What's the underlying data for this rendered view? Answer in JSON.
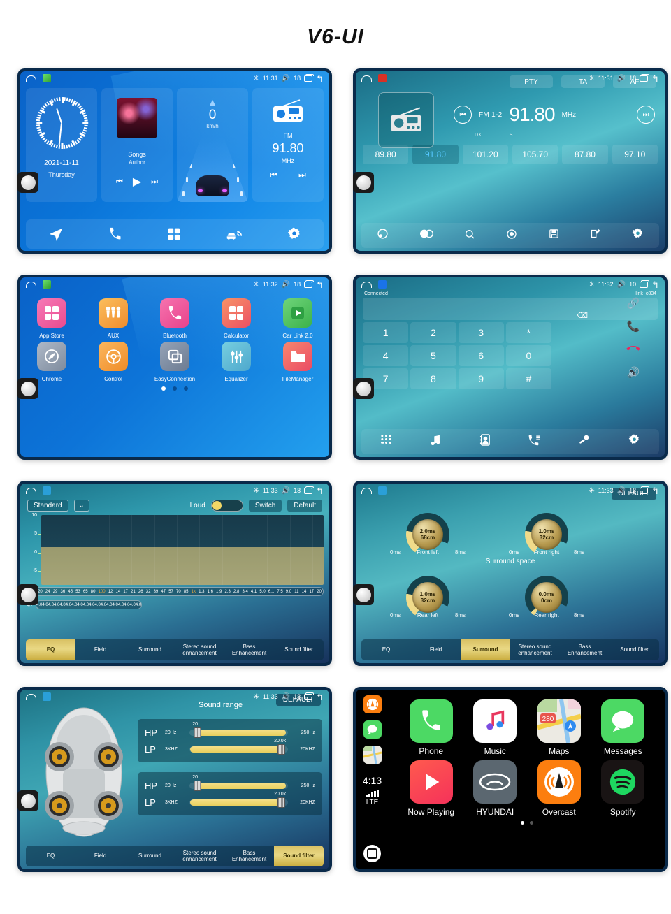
{
  "page": {
    "title": "V6-UI"
  },
  "screens": {
    "home": {
      "status": {
        "time": "11:31",
        "volume": "18",
        "bt_icon": "bluetooth-icon",
        "vol_icon": "volume-icon"
      },
      "clock": {
        "date": "2021-11-11",
        "weekday": "Thursday"
      },
      "music": {
        "title": "Songs",
        "author": "Author",
        "prev": "prev-track",
        "play": "play",
        "next": "next-track"
      },
      "drive": {
        "speed": "0",
        "unit": "km/h"
      },
      "radio": {
        "band": "FM",
        "freq": "91.80",
        "unit": "MHz"
      },
      "dock": [
        "navigation-icon",
        "phone-icon",
        "apps-icon",
        "carlink-icon",
        "settings-icon"
      ]
    },
    "radio": {
      "status": {
        "time": "11:31",
        "volume": "18"
      },
      "rds": [
        "PTY",
        "TA",
        "AF"
      ],
      "band": "FM 1-2",
      "freq": "91.80",
      "unit": "MHz",
      "dx": "DX",
      "st": "ST",
      "presets": [
        "89.80",
        "91.80",
        "101.20",
        "105.70",
        "87.80",
        "97.10"
      ],
      "active_preset_index": 1,
      "dock": [
        "loudness-icon",
        "stereo-icon",
        "search-icon",
        "scan-icon",
        "save-icon",
        "edit-icon",
        "settings-icon"
      ]
    },
    "apps": {
      "status": {
        "time": "11:32",
        "volume": "18"
      },
      "items": [
        {
          "label": "App Store",
          "icon": "grid-icon",
          "color": "#f05b9a"
        },
        {
          "label": "AUX",
          "icon": "aux-icon",
          "color": "#f6a43c"
        },
        {
          "label": "Bluetooth",
          "icon": "phone-icon",
          "color": "#ef4f9c"
        },
        {
          "label": "Calculator",
          "icon": "calculator-icon",
          "color": "#f26a5a"
        },
        {
          "label": "Car Link 2.0",
          "icon": "play-circle-icon",
          "color": "#4fca52"
        },
        {
          "label": "Chrome",
          "icon": "compass-icon",
          "color": "#9aa4b4"
        },
        {
          "label": "Control",
          "icon": "steering-wheel-icon",
          "color": "#f6a43c"
        },
        {
          "label": "EasyConnection",
          "icon": "screen-mirror-icon",
          "color": "#7f8da1"
        },
        {
          "label": "Equalizer",
          "icon": "sliders-icon",
          "color": "#5ab6cf"
        },
        {
          "label": "FileManager",
          "icon": "folder-icon",
          "color": "#f0566b"
        }
      ],
      "page_dots": 3,
      "active_page": 0
    },
    "dialer": {
      "status": {
        "time": "11:32",
        "volume": "10"
      },
      "connection_status": "Connected",
      "device_name": "link_c834",
      "input_value": "",
      "backspace_icon": "backspace-icon",
      "keys": [
        "1",
        "2",
        "3",
        "*",
        "4",
        "5",
        "6",
        "0",
        "7",
        "8",
        "9",
        "#"
      ],
      "side_actions": [
        "link-icon",
        "call-icon",
        "hangup-icon",
        "speaker-icon"
      ],
      "dock": [
        "keypad-icon",
        "music-icon",
        "contacts-icon",
        "call-log-icon",
        "bt-connect-icon",
        "settings-icon"
      ]
    },
    "eq": {
      "status": {
        "time": "11:33",
        "volume": "18"
      },
      "preset": "Standard",
      "loud_label": "Loud",
      "loud_on": true,
      "switch_label": "Switch",
      "default_label": "Default",
      "y_labels": [
        "10",
        "5",
        "0",
        "-5"
      ],
      "frequencies": [
        "20",
        "24",
        "29",
        "36",
        "45",
        "53",
        "65",
        "80",
        "100",
        "12",
        "14",
        "17",
        "21",
        "26",
        "32",
        "39",
        "47",
        "57",
        "70",
        "85",
        "1k",
        "1.3",
        "1.6",
        "1.9",
        "2.3",
        "2.8",
        "3.4",
        "4.1",
        "5.0",
        "6.1",
        "7.5",
        "9.0",
        "11",
        "14",
        "17",
        "20"
      ],
      "highlighted_frequencies": [
        "100",
        "1k"
      ],
      "q_label": "Q:",
      "q_values": [
        "4.0",
        "4.0",
        "4.0",
        "4.0",
        "4.0",
        "4.0",
        "4.0",
        "4.0",
        "4.0",
        "4.0",
        "4.0",
        "4.0",
        "4.0",
        "4.0",
        "4.0",
        "4.0",
        "4.0",
        "4.0"
      ],
      "tabs": [
        "EQ",
        "Field",
        "Surround",
        "Stereo sound enhancement",
        "Bass Enhancement",
        "Sound filter"
      ],
      "active_tab": "EQ"
    },
    "surround": {
      "status": {
        "time": "11:33",
        "volume": "18"
      },
      "default_label": "DEFAULT",
      "section_title": "Surround space",
      "knobs": [
        {
          "name": "Front left",
          "value_ms": "2.0ms",
          "value_cm": "68cm",
          "min": "0ms",
          "max": "8ms"
        },
        {
          "name": "Front right",
          "value_ms": "1.0ms",
          "value_cm": "32cm",
          "min": "0ms",
          "max": "8ms"
        },
        {
          "name": "Rear left",
          "value_ms": "1.0ms",
          "value_cm": "32cm",
          "min": "0ms",
          "max": "8ms"
        },
        {
          "name": "Rear right",
          "value_ms": "0.0ms",
          "value_cm": "0cm",
          "min": "0ms",
          "max": "8ms"
        }
      ],
      "tabs": [
        "EQ",
        "Field",
        "Surround",
        "Stereo sound enhancement",
        "Bass Enhancement",
        "Sound filter"
      ],
      "active_tab": "Surround"
    },
    "sound_filter": {
      "status": {
        "time": "11:33",
        "volume": "18"
      },
      "title": "Sound range",
      "default_label": "DEFAULT",
      "groups": [
        {
          "rows": [
            {
              "label": "HP",
              "min": "20Hz",
              "max": "250Hz",
              "value": "20"
            },
            {
              "label": "LP",
              "min": "3KHZ",
              "max": "20KHZ",
              "value": "20.0k"
            }
          ]
        },
        {
          "rows": [
            {
              "label": "HP",
              "min": "20Hz",
              "max": "250Hz",
              "value": "20"
            },
            {
              "label": "LP",
              "min": "3KHZ",
              "max": "20KHZ",
              "value": "20.0k"
            }
          ]
        }
      ],
      "tabs": [
        "EQ",
        "Field",
        "Surround",
        "Stereo sound enhancement",
        "Bass Enhancement",
        "Sound filter"
      ],
      "active_tab": "Sound filter"
    },
    "carplay": {
      "sidebar": {
        "time": "4:13",
        "network": "LTE",
        "icons": [
          "overcast-icon",
          "messages-icon",
          "maps-icon",
          "home-button"
        ]
      },
      "apps": [
        {
          "label": "Phone",
          "icon": "phone-icon"
        },
        {
          "label": "Music",
          "icon": "music-note-icon"
        },
        {
          "label": "Maps",
          "icon": "maps-icon"
        },
        {
          "label": "Messages",
          "icon": "messages-icon"
        },
        {
          "label": "Now Playing",
          "icon": "play-icon"
        },
        {
          "label": "HYUNDAI",
          "icon": "hyundai-logo-icon"
        },
        {
          "label": "Overcast",
          "icon": "overcast-icon"
        },
        {
          "label": "Spotify",
          "icon": "spotify-icon"
        }
      ],
      "page_dots": 2,
      "active_page": 0
    }
  }
}
